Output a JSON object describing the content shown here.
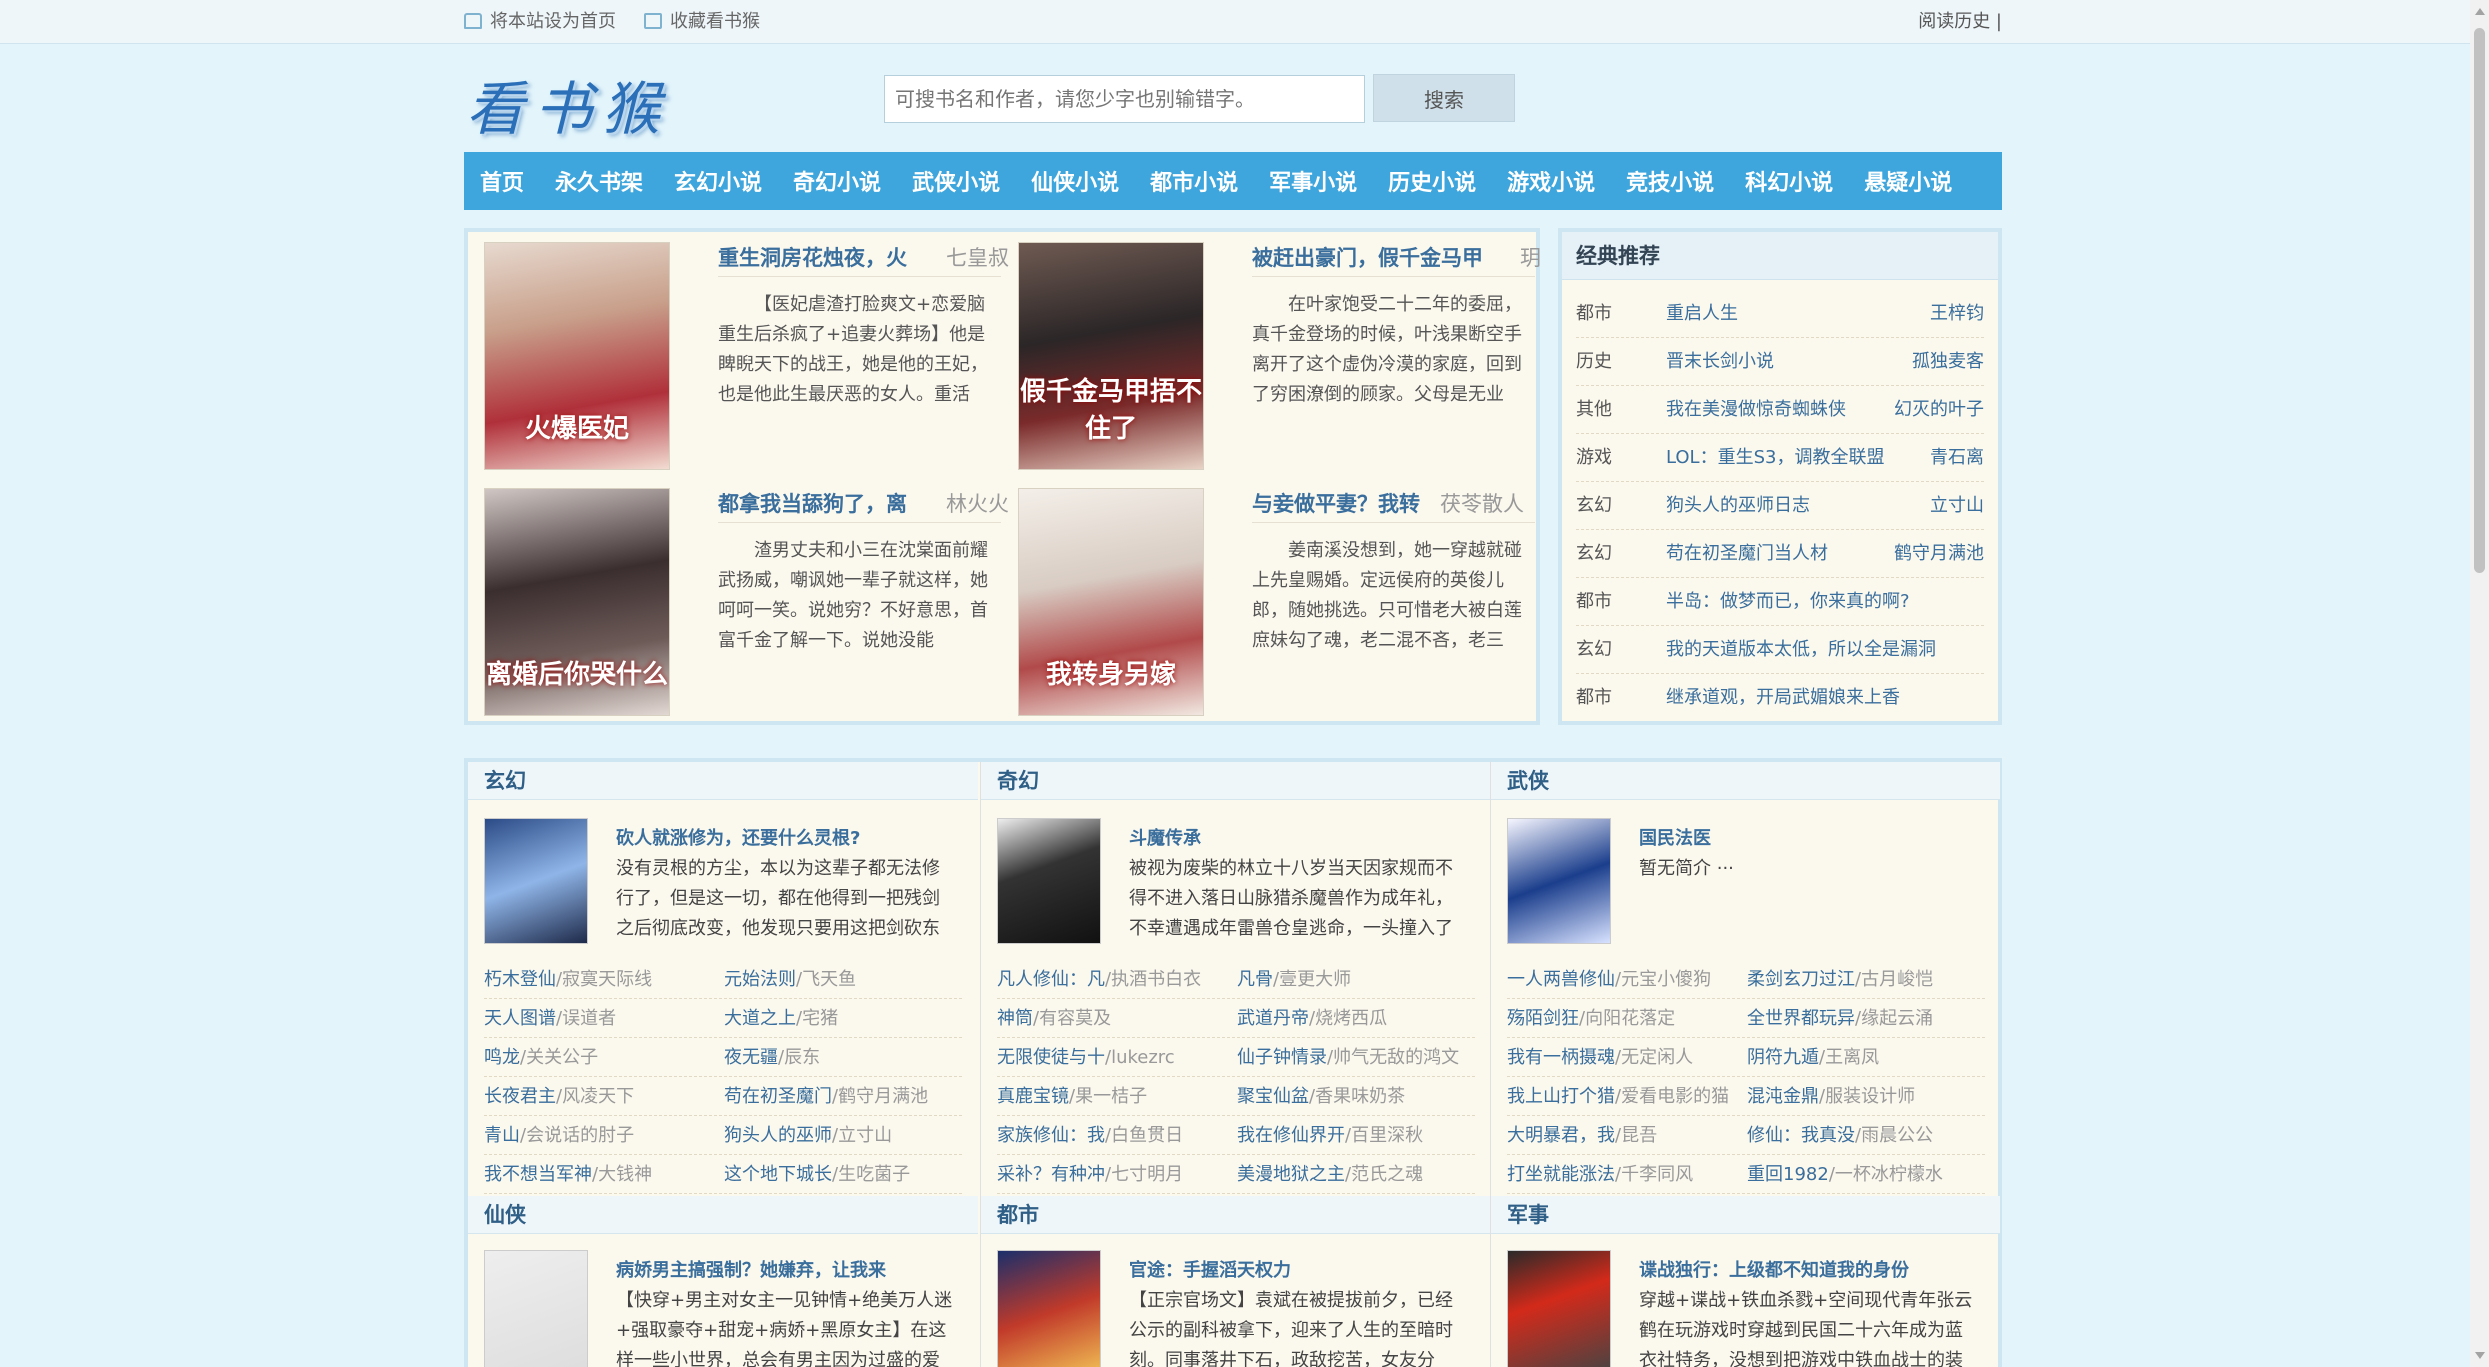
{
  "topbar": {
    "set_home": "将本站设为首页",
    "bookmark": "收藏看书猴",
    "history": "阅读历史 |"
  },
  "logo": "看书猴",
  "search": {
    "placeholder": "可搜书名和作者，请您少字也别输错字。",
    "button": "搜索"
  },
  "nav": [
    "首页",
    "永久书架",
    "玄幻小说",
    "奇幻小说",
    "武侠小说",
    "仙侠小说",
    "都市小说",
    "军事小说",
    "历史小说",
    "游戏小说",
    "竞技小说",
    "科幻小说",
    "悬疑小说"
  ],
  "featured": [
    {
      "title": "重生洞房花烛夜，火",
      "author": "七皇叔",
      "desc": "【医妃虐渣打脸爽文+恋爱脑重生后杀疯了+追妻火葬场】他是睥睨天下的战王，她是他的王妃，也是他此生最厌恶的女人。重活",
      "cover_text": "火爆医妃"
    },
    {
      "title": "被赶出豪门，假千金马甲",
      "author": "玥",
      "desc": "在叶家饱受二十二年的委屈，真千金登场的时候，叶浅果断空手离开了这个虚伪冷漠的家庭，回到了穷困潦倒的顾家。父母是无业",
      "cover_text": "假千金马甲捂不住了"
    },
    {
      "title": "都拿我当舔狗了，离",
      "author": "林火火",
      "desc": "渣男丈夫和小三在沈棠面前耀武扬威，嘲讽她一辈子就这样，她呵呵一笑。说她穷？不好意思，首富千金了解一下。说她没能",
      "cover_text": "离婚后你哭什么"
    },
    {
      "title": "与妾做平妻？我转",
      "author": "茯苓散人",
      "desc": "姜南溪没想到，她一穿越就碰上先皇赐婚。定远侯府的英俊儿郎，随她挑选。只可惜老大被白莲庶妹勾了魂，老二混不吝，老三",
      "cover_text": "我转身另嫁"
    }
  ],
  "recommend": {
    "title": "经典推荐",
    "items": [
      {
        "cat": "都市",
        "name": "重启人生",
        "author": "王梓钧"
      },
      {
        "cat": "历史",
        "name": "晋末长剑小说",
        "author": "孤独麦客"
      },
      {
        "cat": "其他",
        "name": "我在美漫做惊奇蜘蛛侠",
        "author": "幻灭的叶子"
      },
      {
        "cat": "游戏",
        "name": "LOL：重生S3，调教全联盟",
        "author": "青石离"
      },
      {
        "cat": "玄幻",
        "name": "狗头人的巫师日志",
        "author": "立寸山"
      },
      {
        "cat": "玄幻",
        "name": "苟在初圣魔门当人材",
        "author": "鹤守月满池"
      },
      {
        "cat": "都市",
        "name": "半岛：做梦而已，你来真的啊?",
        "author": ""
      },
      {
        "cat": "玄幻",
        "name": "我的天道版本太低，所以全是漏洞",
        "author": ""
      },
      {
        "cat": "都市",
        "name": "继承道观，开局武媚娘来上香",
        "author": ""
      }
    ]
  },
  "categories": [
    {
      "name": "玄幻",
      "top": {
        "title": "砍人就涨修为，还要什么灵根?",
        "desc": "没有灵根的方尘，本以为这辈子都无法修行了，但是这一切，都在他得到一把残剑之后彻底改变，他发现只要用这把剑砍东"
      },
      "list": [
        {
          "n": "朽木登仙",
          "a": "/寂寞天际线"
        },
        {
          "n": "元始法则",
          "a": "/飞天鱼"
        },
        {
          "n": "天人图谱",
          "a": "/误道者"
        },
        {
          "n": "大道之上",
          "a": "/宅猪"
        },
        {
          "n": "鸣龙",
          "a": "/关关公子"
        },
        {
          "n": "夜无疆",
          "a": "/辰东"
        },
        {
          "n": "长夜君主",
          "a": "/风凌天下"
        },
        {
          "n": "苟在初圣魔门",
          "a": "/鹤守月满池"
        },
        {
          "n": "青山",
          "a": "/会说话的肘子"
        },
        {
          "n": "狗头人的巫师",
          "a": "/立寸山"
        },
        {
          "n": "我不想当军神",
          "a": "/大钱神"
        },
        {
          "n": "这个地下城长",
          "a": "/生吃菌子"
        }
      ]
    },
    {
      "name": "奇幻",
      "top": {
        "title": "斗魔传承",
        "desc": "被视为废柴的林立十八岁当天因家规而不得不进入落日山脉猎杀魔兽作为成年礼，不幸遭遇成年雷兽仓皇逃命，一头撞入了"
      },
      "list": [
        {
          "n": "凡人修仙：凡",
          "a": "/执酒书白衣"
        },
        {
          "n": "凡骨",
          "a": "/壹更大师"
        },
        {
          "n": "神筒",
          "a": "/有容莫及"
        },
        {
          "n": "武道丹帝",
          "a": "/烧烤西瓜"
        },
        {
          "n": "无限使徒与十",
          "a": "/lukezrc"
        },
        {
          "n": "仙子钟情录",
          "a": "/帅气无敌的鸿文"
        },
        {
          "n": "真鹿宝镜",
          "a": "/果一桔子"
        },
        {
          "n": "聚宝仙盆",
          "a": "/香果味奶茶"
        },
        {
          "n": "家族修仙：我",
          "a": "/白鱼贯日"
        },
        {
          "n": "我在修仙界开",
          "a": "/百里深秋"
        },
        {
          "n": "采补？有种冲",
          "a": "/七寸明月"
        },
        {
          "n": "美漫地狱之主",
          "a": "/范氏之魂"
        }
      ]
    },
    {
      "name": "武侠",
      "top": {
        "title": "国民法医",
        "desc": "暂无简介 ···"
      },
      "list": [
        {
          "n": "一人两兽修仙",
          "a": "/元宝小傻狗"
        },
        {
          "n": "柔剑玄刀过江",
          "a": "/古月峻恺"
        },
        {
          "n": "殇陌剑狂",
          "a": "/向阳花落定"
        },
        {
          "n": "全世界都玩异",
          "a": "/缘起云涌"
        },
        {
          "n": "我有一柄摄魂",
          "a": "/无定闲人"
        },
        {
          "n": "阴符九遁",
          "a": "/王离凤"
        },
        {
          "n": "我上山打个猎",
          "a": "/爱看电影的猫"
        },
        {
          "n": "混沌金鼎",
          "a": "/服装设计师"
        },
        {
          "n": "大明暴君，我",
          "a": "/昆吾"
        },
        {
          "n": "修仙：我真没",
          "a": "/雨晨公公"
        },
        {
          "n": "打坐就能涨法",
          "a": "/千李同风"
        },
        {
          "n": "重回1982",
          "a": "/一杯冰柠檬水"
        }
      ]
    }
  ],
  "categories2": [
    {
      "name": "仙侠",
      "top": {
        "title": "病娇男主搞强制？她嫌弃，让我来",
        "desc": "【快穿+男主对女主一见钟情+绝美万人迷+强取豪夺+甜宠+病娇+黑原女主】在这样一些小世界，总会有男主因为过盛的爱"
      }
    },
    {
      "name": "都市",
      "top": {
        "title": "官途：手握滔天权力",
        "desc": "【正宗官场文】袁斌在被提拔前夕，已经公示的副科被拿下，迎来了人生的至暗时刻。同事落井下石，政敌挖苦，女友分"
      }
    },
    {
      "name": "军事",
      "top": {
        "title": "谍战独行：上级都不知道我的身份",
        "desc": "穿越+谍战+铁血杀戮+空间现代青年张云鹤在玩游戏时穿越到民国二十六年成为蓝衣社特务，没想到把游戏中铁血战士的装"
      }
    }
  ]
}
